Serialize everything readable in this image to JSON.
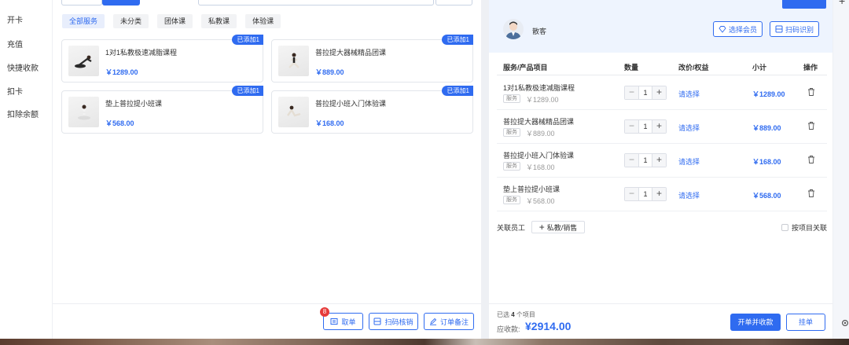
{
  "sidebar": {
    "items": [
      {
        "label": "开卡"
      },
      {
        "label": "充值"
      },
      {
        "label": "快捷收款"
      },
      {
        "label": "扣卡"
      },
      {
        "label": "扣除余额"
      }
    ]
  },
  "categories": [
    {
      "label": "全部服务",
      "active": true
    },
    {
      "label": "未分类"
    },
    {
      "label": "团体课"
    },
    {
      "label": "私教课"
    },
    {
      "label": "体验课"
    }
  ],
  "courses": [
    {
      "name": "1对1私教极速减脂课程",
      "price": "￥1289.00",
      "badge": "已添加1"
    },
    {
      "name": "普拉提大器械精品团课",
      "price": "￥889.00",
      "badge": "已添加1"
    },
    {
      "name": "垫上普拉提小班课",
      "price": "￥568.00",
      "badge": "已添加1"
    },
    {
      "name": "普拉提小班入门体验课",
      "price": "￥168.00",
      "badge": "已添加1"
    }
  ],
  "left_footer": {
    "take_order": "取单",
    "take_order_count": "8",
    "scan_verify": "扫码核销",
    "order_note": "订单备注"
  },
  "member": {
    "guest_label": "散客",
    "select_member": "选择会员",
    "scan_identify": "扫码识别"
  },
  "table": {
    "headers": {
      "item": "服务/产品项目",
      "qty": "数量",
      "price_edit": "改价/权益",
      "subtotal": "小计",
      "action": "操作"
    },
    "rows": [
      {
        "name": "1对1私教极速减脂课程",
        "tag": "服务",
        "orig": "￥1289.00",
        "qty": "1",
        "select": "请选择",
        "subtotal": "￥1289.00"
      },
      {
        "name": "普拉提大器械精品团课",
        "tag": "服务",
        "orig": "￥889.00",
        "qty": "1",
        "select": "请选择",
        "subtotal": "￥889.00"
      },
      {
        "name": "普拉提小班入门体验课",
        "tag": "服务",
        "orig": "￥168.00",
        "qty": "1",
        "select": "请选择",
        "subtotal": "￥168.00"
      },
      {
        "name": "垫上普拉提小班课",
        "tag": "服务",
        "orig": "￥568.00",
        "qty": "1",
        "select": "请选择",
        "subtotal": "￥568.00"
      }
    ]
  },
  "staff": {
    "label": "关联员工",
    "button": "私教/销售",
    "by_item": "按项目关联"
  },
  "summary": {
    "selected_prefix": "已选",
    "selected_count": "4",
    "selected_suffix": "个项目",
    "due_label": "应收款:",
    "due_amount": "¥2914.00",
    "open_and_collect": "开单并收款",
    "hang_order": "挂单"
  },
  "colors": {
    "accent": "#2f6bf0",
    "badge_red": "#e63b3b"
  }
}
